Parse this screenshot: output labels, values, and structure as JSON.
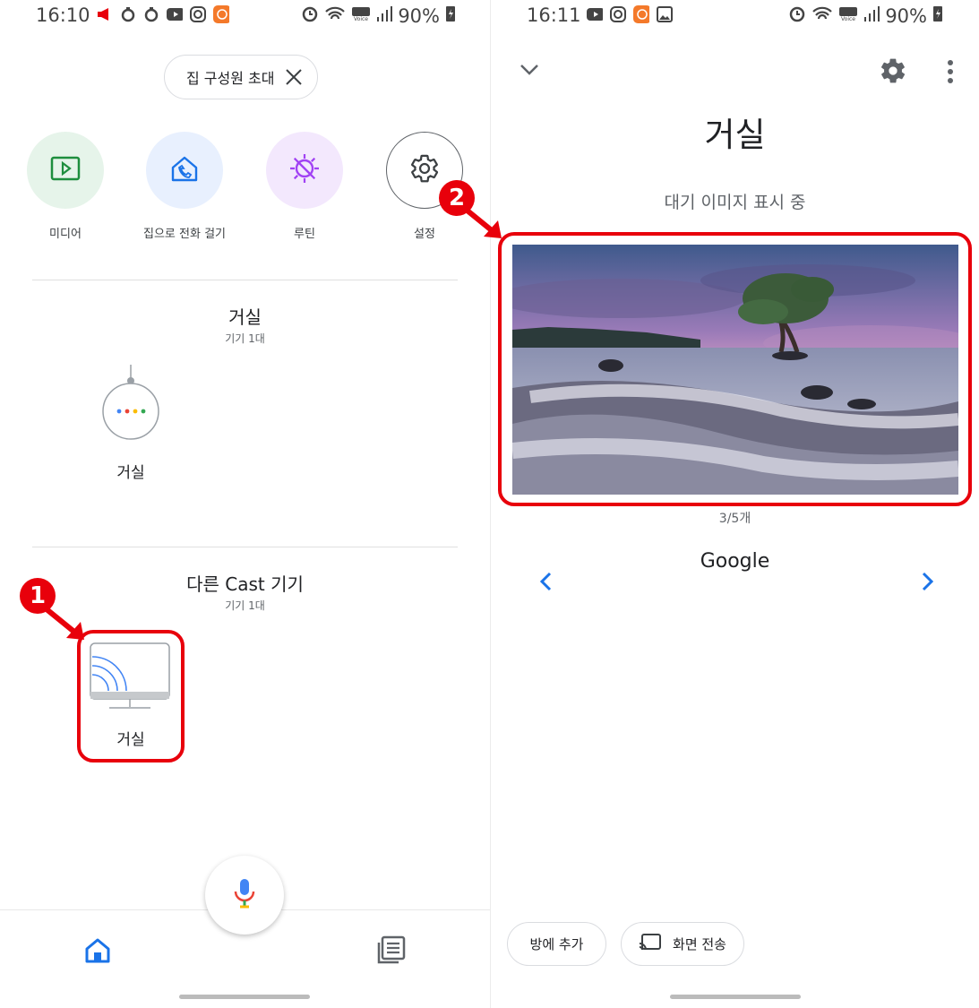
{
  "left": {
    "status": {
      "time": "16:10",
      "battery": "90%"
    },
    "invite_chip": "집 구성원 초대",
    "shortcuts": [
      {
        "label": "미디어",
        "icon": "media-play-icon",
        "bg": "#e6f4ea"
      },
      {
        "label": "집으로 전화 걸기",
        "icon": "home-call-icon",
        "bg": "#e8f0fe"
      },
      {
        "label": "루틴",
        "icon": "routine-icon",
        "bg": "#f3e8fd"
      },
      {
        "label": "설정",
        "icon": "gear-icon",
        "bg": "#ffffff"
      }
    ],
    "rooms": [
      {
        "title": "거실",
        "subtitle": "기기 1대",
        "device_label": "거실",
        "device_type": "speaker"
      },
      {
        "title": "다른 Cast 기기",
        "subtitle": "기기 1대",
        "device_label": "거실",
        "device_type": "tv"
      }
    ],
    "annotation_number": "1"
  },
  "right": {
    "status": {
      "time": "16:11",
      "battery": "90%"
    },
    "room_title": "거실",
    "ambient_label": "대기 이미지 표시 중",
    "photo_counter": "3/5개",
    "photo_source": "Google",
    "chips": [
      {
        "label": "방에 추가"
      },
      {
        "label": "화면 전송"
      }
    ],
    "annotation_number": "2"
  },
  "colors": {
    "annotation_red": "#e8000b",
    "accent_blue": "#4285f4",
    "media_green": "#1e8e3e",
    "routine_purple": "#a142f4"
  }
}
